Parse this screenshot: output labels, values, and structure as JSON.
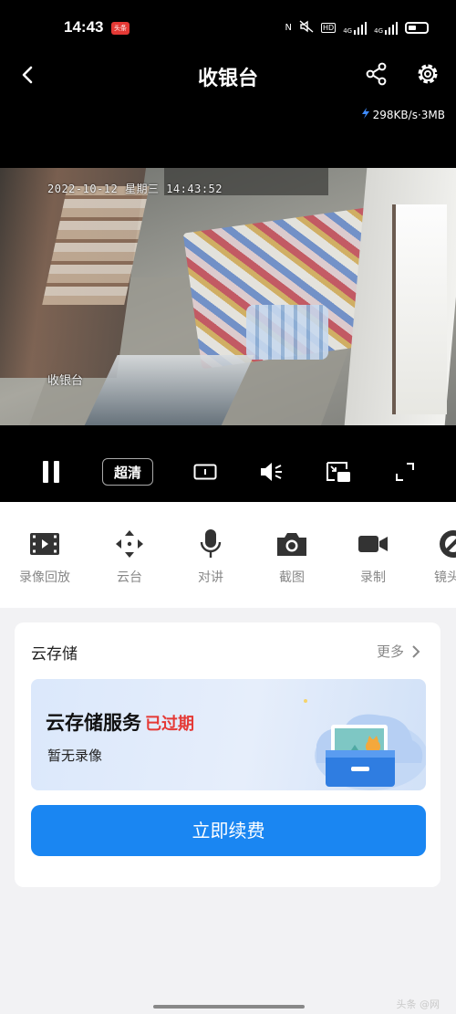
{
  "status_bar": {
    "time": "14:43",
    "app_badge": "头条",
    "indicators": [
      "N",
      "HD",
      "4G",
      "4G"
    ]
  },
  "header": {
    "title": "收银台",
    "speed": "298KB/s·3MB"
  },
  "video": {
    "timestamp": "2022-10-12 星期三 14:43:52",
    "camera_label": "收银台"
  },
  "controls": {
    "quality_label": "超清"
  },
  "toolbar": {
    "items": [
      {
        "label": "录像回放",
        "icon": "film-icon"
      },
      {
        "label": "云台",
        "icon": "ptz-arrows-icon"
      },
      {
        "label": "对讲",
        "icon": "microphone-icon"
      },
      {
        "label": "截图",
        "icon": "camera-icon"
      },
      {
        "label": "录制",
        "icon": "video-camera-icon"
      },
      {
        "label": "镜头遮",
        "icon": "lens-cover-icon"
      }
    ]
  },
  "cloud_card": {
    "title": "云存储",
    "more_label": "更多",
    "banner_title": "云存储服务",
    "banner_status": "已过期",
    "banner_subtitle": "暂无录像",
    "renew_label": "立即续费"
  },
  "watermark": "头条 @网",
  "colors": {
    "accent": "#1a86f2",
    "expired": "#e53935",
    "dark_bg": "#000000",
    "page_bg": "#f2f2f4"
  }
}
